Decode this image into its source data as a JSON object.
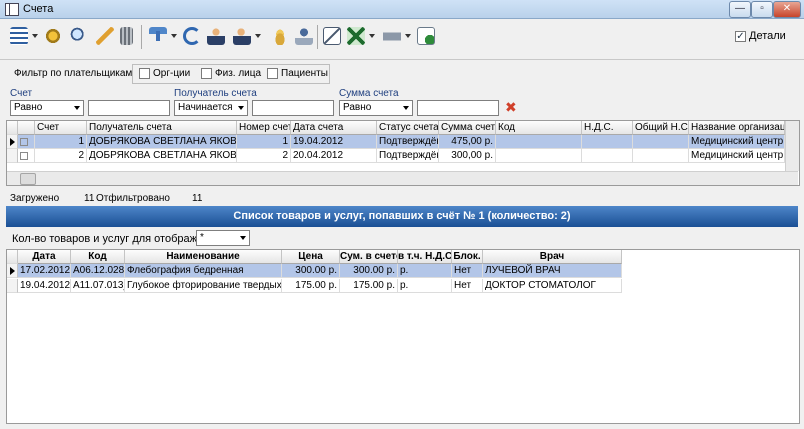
{
  "window": {
    "title": "Счета",
    "minimize_glyph": "—",
    "restore_glyph": "▫",
    "close_glyph": "✕"
  },
  "toolbar": {
    "icons": [
      "list-icon",
      "settings-icon",
      "search-icon",
      "pen-icon",
      "trash-icon",
      "filter-icon",
      "refresh-icon",
      "user-cursor-icon",
      "user-info-icon",
      "coins-icon",
      "stamp-icon",
      "edit-icon",
      "excel-icon",
      "print-icon",
      "exit-icon"
    ],
    "details_label": "Детали",
    "details_checked": true
  },
  "filter_payers": {
    "label": "Фильтр по плательщикам:",
    "options": [
      {
        "label": "Орг-ции",
        "checked": false
      },
      {
        "label": "Физ. лица",
        "checked": false
      },
      {
        "label": "Пациенты",
        "checked": false
      }
    ]
  },
  "filters": {
    "account": {
      "label": "Счет",
      "op": "Равно",
      "value": ""
    },
    "recipient": {
      "label": "Получатель счета",
      "op": "Начинается",
      "value": ""
    },
    "amount": {
      "label": "Сумма счета",
      "op": "Равно",
      "value": ""
    }
  },
  "accounts_grid": {
    "columns": [
      "Счет",
      "Получатель счета",
      "Номер счета",
      "Дата счета",
      "Статус счета",
      "Сумма счета",
      "Код",
      "Н.Д.С.",
      "Общий Н.С.П.",
      "Название организации"
    ],
    "rows": [
      {
        "id": "1",
        "recipient": "ДОБРЯКОВА СВЕТЛАНА ЯКОВЛЕВНА",
        "number": "1",
        "date": "19.04.2012",
        "status": "Подтверждён",
        "sum": "475,00 р.",
        "code": "",
        "nds": "",
        "nsp": "",
        "org": "Медицинский центр"
      },
      {
        "id": "2",
        "recipient": "ДОБРЯКОВА СВЕТЛАНА ЯКОВЛЕВНА",
        "number": "2",
        "date": "20.04.2012",
        "status": "Подтверждён",
        "sum": "300,00 р.",
        "code": "",
        "nds": "",
        "nsp": "",
        "org": "Медицинский центр"
      }
    ]
  },
  "stats": {
    "loaded_label": "Загружено",
    "loaded": "11",
    "filtered_label": "Отфильтровано",
    "filtered": "11"
  },
  "items_panel": {
    "title": "Список товаров и услуг, попавших в счёт № 1 (количество: 2)",
    "count_label": "Кол-во товаров и услуг для отображения:",
    "count_value": "*",
    "columns": [
      "Дата",
      "Код",
      "Наименование",
      "Цена",
      "Сум. в счете",
      "в т.ч. Н.Д.С.",
      "Блок.",
      "Врач"
    ],
    "rows": [
      {
        "date": "17.02.2012",
        "code": "A06.12.028_",
        "name": "Флебография бедренная",
        "price": "300.00 р.",
        "sum": "300.00 р.",
        "nds": "р.",
        "block": "Нет",
        "doctor": "ЛУЧЕВОЙ ВРАЧ"
      },
      {
        "date": "19.04.2012",
        "code": "A11.07.013_",
        "name": "Глубокое фторирование твердых тканей",
        "price": "175.00 р.",
        "sum": "175.00 р.",
        "nds": "р.",
        "block": "Нет",
        "doctor": "ДОКТОР СТОМАТОЛОГ"
      }
    ]
  }
}
